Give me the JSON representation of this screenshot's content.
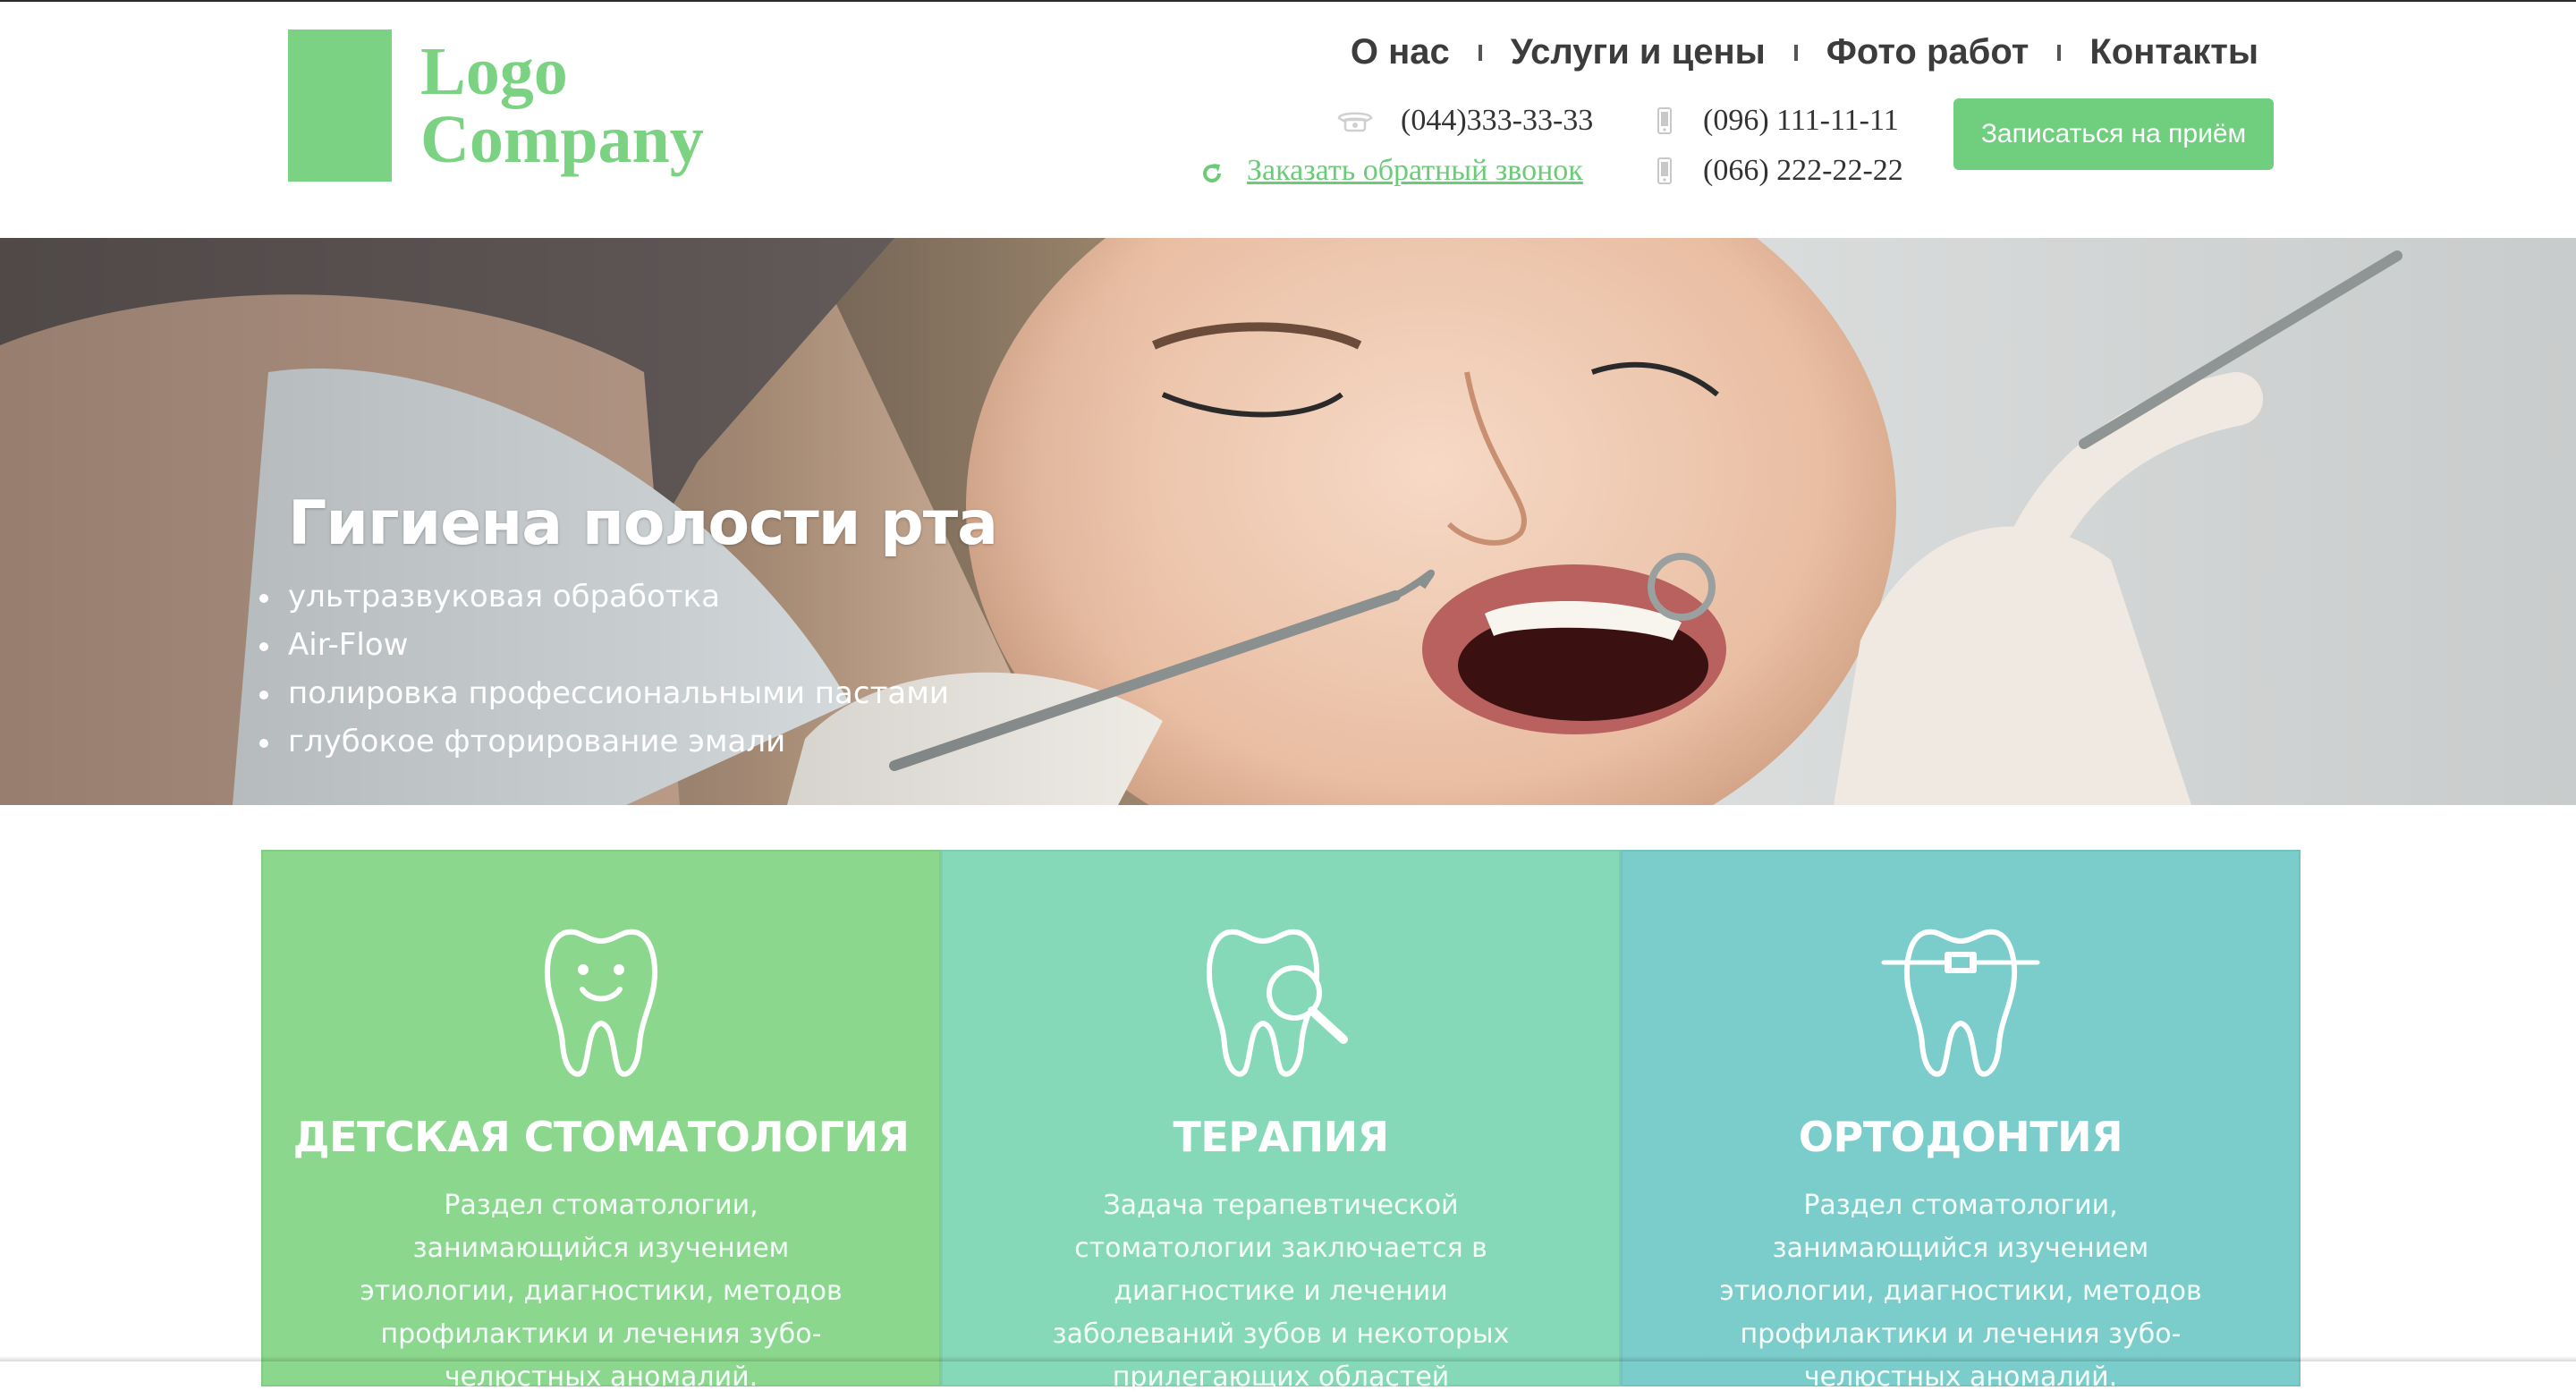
{
  "logo": {
    "line1": "Logo",
    "line2": "Company"
  },
  "nav": {
    "items": [
      {
        "label": "О нас"
      },
      {
        "label": "Услуги и цены"
      },
      {
        "label": "Фото работ"
      },
      {
        "label": "Контакты"
      }
    ]
  },
  "contacts": {
    "landline": "(044)333-33-33",
    "mobile1": "(096) 111-11-11",
    "mobile2": "(066) 222-22-22",
    "callback_label": "Заказать обратный звонок",
    "icons": [
      "phone-icon",
      "mobile-icon",
      "refresh-icon"
    ]
  },
  "header": {
    "appointment_label": "Записаться на приём"
  },
  "hero": {
    "title": "Гигиена полости рта",
    "items": [
      "ультразвуковая обработка",
      "Air-Flow",
      "полировка профессиональными пастами",
      "глубокое фторирование эмали"
    ]
  },
  "cards": [
    {
      "icon": "smiling-tooth-icon",
      "title": "ДЕТСКАЯ СТОМАТОЛОГИЯ",
      "text": "Раздел стоматологии, занимающийся изучением этиологии, диагностики, методов профилактики и лечения зубо-челюстных аномалий.",
      "color": "#8cd78e"
    },
    {
      "icon": "tooth-magnifier-icon",
      "title": "ТЕРАПИЯ",
      "text": "Задача терапевтической стоматологии заключается в диагностике и лечении заболеваний зубов и некоторых прилегающих областей",
      "color": "#85d9b8"
    },
    {
      "icon": "tooth-braces-icon",
      "title": "ОРТОДОНТИЯ",
      "text": "Раздел стоматологии, занимающийся изучением этиологии, диагностики, методов профилактики и лечения зубо-челюстных аномалий.",
      "color": "#7bcdcb"
    }
  ],
  "colors": {
    "brand_green": "#7bd283",
    "button_green": "#6fcf7e",
    "link_green": "#6ccb79"
  }
}
